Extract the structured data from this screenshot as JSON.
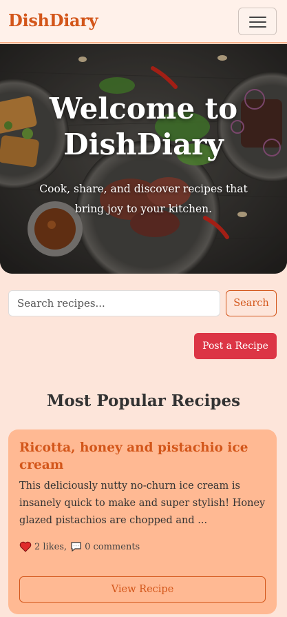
{
  "navbar": {
    "brand": "DishDiary",
    "menu_icon": "hamburger-menu-icon"
  },
  "hero": {
    "title": "Welcome to DishDiary",
    "subtitle": "Cook, share, and discover recipes that bring joy to your kitchen."
  },
  "search": {
    "placeholder": "Search recipes...",
    "value": "",
    "button_label": "Search",
    "icon": "search-icon"
  },
  "actions": {
    "post_label": "Post a Recipe"
  },
  "section": {
    "title": "Most Popular Recipes"
  },
  "recipes": [
    {
      "title": "Ricotta, honey and pistachio ice cream",
      "description": "This deliciously nutty no-churn ice cream is insanely quick to make and super stylish! Honey glazed pistachios are chopped and ...",
      "likes": "2 likes,",
      "comments": "0 comments",
      "like_icon": "heart-icon",
      "comment_icon": "comment-icon",
      "button_label": "View Recipe"
    }
  ],
  "colors": {
    "accent": "#d3561a",
    "danger": "#dc3545",
    "background": "#fde5da",
    "card": "#ffb993"
  }
}
